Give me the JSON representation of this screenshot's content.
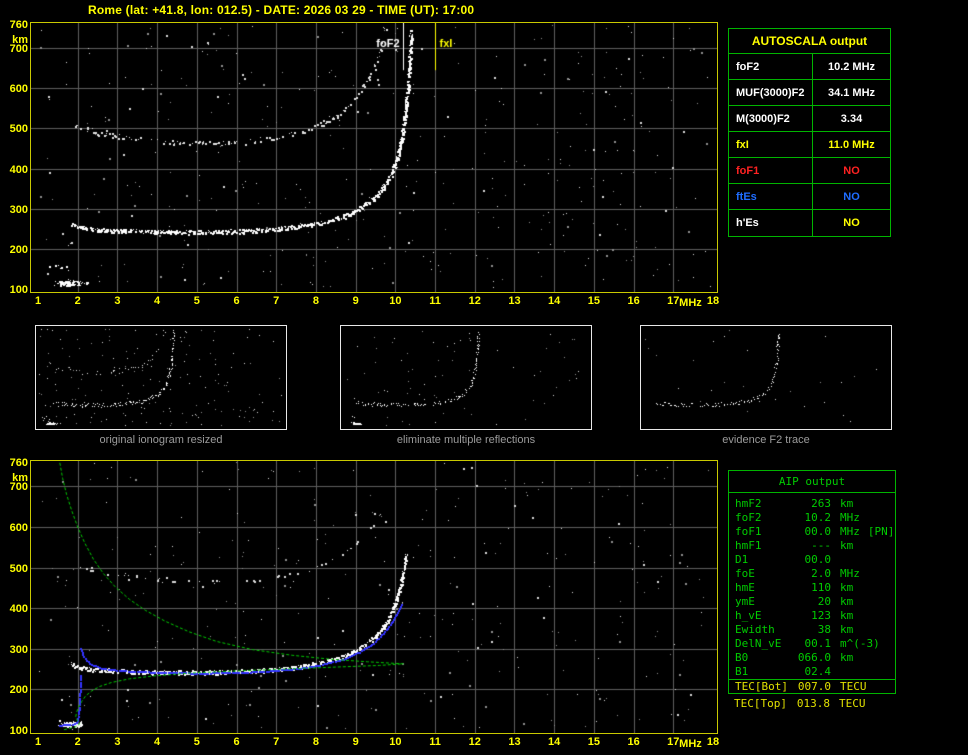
{
  "title": "Rome (lat: +41.8, lon: 012.5) - DATE: 2026 03 29 - TIME (UT): 17:00",
  "autoscala_table": {
    "header": "AUTOSCALA output",
    "rows": [
      {
        "label": "foF2",
        "value": "10.2 MHz",
        "color": "#ffffff"
      },
      {
        "label": "MUF(3000)F2",
        "value": "34.1 MHz",
        "color": "#ffffff"
      },
      {
        "label": "M(3000)F2",
        "value": "3.34",
        "color": "#ffffff"
      },
      {
        "label": "fxI",
        "value": "11.0 MHz",
        "color": "#ffff00"
      },
      {
        "label": "foF1",
        "value": "NO",
        "color": "#ff2222"
      },
      {
        "label": "ftEs",
        "value": "NO",
        "color": "#1f6dff"
      },
      {
        "label": "h'Es",
        "value": "NO",
        "color": "#ffffff",
        "value_color": "#ffff00"
      }
    ]
  },
  "aip_table": {
    "header": "AIP output",
    "rows": [
      {
        "label": "hmF2",
        "value": "263",
        "unit": "km",
        "extra": ""
      },
      {
        "label": "foF2",
        "value": "10.2",
        "unit": "MHz",
        "extra": ""
      },
      {
        "label": "foF1",
        "value": "00.0",
        "unit": "MHz",
        "extra": "[PN]"
      },
      {
        "label": "hmF1",
        "value": "---",
        "unit": "km",
        "extra": ""
      },
      {
        "label": "D1",
        "value": "00.0",
        "unit": "",
        "extra": ""
      },
      {
        "label": "foE",
        "value": "2.0",
        "unit": "MHz",
        "extra": ""
      },
      {
        "label": "hmE",
        "value": "110",
        "unit": "km",
        "extra": ""
      },
      {
        "label": "ymE",
        "value": "20",
        "unit": "km",
        "extra": ""
      },
      {
        "label": "h_vE",
        "value": "123",
        "unit": "km",
        "extra": ""
      },
      {
        "label": "Ewidth",
        "value": "38",
        "unit": "km",
        "extra": ""
      },
      {
        "label": "DelN_vE",
        "value": "00.1",
        "unit": "m^(-3)",
        "extra": ""
      },
      {
        "label": "B0",
        "value": "066.0",
        "unit": "km",
        "extra": ""
      },
      {
        "label": "B1",
        "value": "02.4",
        "unit": "",
        "extra": ""
      }
    ],
    "tec_bot": {
      "label": "TEC[Bot]",
      "value": "007.0",
      "unit": "TECU"
    },
    "tec_top": {
      "label": "TEC[Top]",
      "value": "013.8",
      "unit": "TECU"
    }
  },
  "thumbnails": [
    {
      "caption": "original ionogram resized",
      "trace_refs": [
        {
          "id": "f2",
          "d": 0.55
        },
        {
          "id": "upper",
          "d": 0.55
        },
        {
          "id": "es",
          "d": 0.6
        },
        {
          "id": "es-arc",
          "d": 0.6
        },
        {
          "id": "noise",
          "d": 0.45
        }
      ]
    },
    {
      "caption": "eliminate multiple reflections",
      "trace_refs": [
        {
          "id": "f2",
          "d": 0.55
        },
        {
          "id": "es",
          "d": 0.5
        },
        {
          "id": "es-arc",
          "d": 0.5
        },
        {
          "id": "noise",
          "d": 0.18
        }
      ]
    },
    {
      "caption": "evidence F2 trace",
      "trace_refs": [
        {
          "id": "f2",
          "d": 0.4
        },
        {
          "id": "noise",
          "d": 0.07
        }
      ]
    }
  ],
  "chart_data": [
    {
      "id": "ionogram_measured",
      "type": "scatter",
      "xlabel": "MHz",
      "ylabel": "km",
      "xlim": [
        1,
        18
      ],
      "ylim": [
        100,
        760
      ],
      "x_ticks": [
        1,
        2,
        3,
        4,
        5,
        6,
        7,
        8,
        9,
        10,
        11,
        12,
        13,
        14,
        15,
        16,
        17,
        18
      ],
      "y_ticks": [
        760,
        700,
        600,
        500,
        400,
        300,
        200,
        100
      ],
      "markers": [
        {
          "label": "foF2",
          "mhz": 10.2,
          "color": "#ffffff",
          "label_side": "left",
          "line_to_km": 645
        },
        {
          "label": "fxI",
          "mhz": 11.0,
          "color": "#ffff00",
          "label_side": "right",
          "line_to_km": 645
        }
      ],
      "traces": [
        {
          "id": "f2",
          "kind": "scatter-path",
          "color": "#ffffff",
          "density": 2.0,
          "jitter": 2.6,
          "gap": 0.3,
          "anchors": [
            [
              1.85,
              262
            ],
            [
              2.1,
              252
            ],
            [
              2.5,
              247
            ],
            [
              3.2,
              244
            ],
            [
              4.0,
              242
            ],
            [
              5.0,
              241
            ],
            [
              6.0,
              243
            ],
            [
              6.8,
              247
            ],
            [
              7.5,
              254
            ],
            [
              8.1,
              264
            ],
            [
              8.7,
              280
            ],
            [
              9.1,
              300
            ],
            [
              9.45,
              324
            ],
            [
              9.7,
              352
            ],
            [
              9.9,
              386
            ],
            [
              10.05,
              425
            ],
            [
              10.15,
              465
            ],
            [
              10.22,
              510
            ],
            [
              10.28,
              560
            ],
            [
              10.33,
              615
            ],
            [
              10.37,
              680
            ],
            [
              10.4,
              745
            ]
          ]
        },
        {
          "id": "upper",
          "kind": "scatter-path",
          "color": "#e0e0e0",
          "density": 0.9,
          "jitter": 3.2,
          "gap": 0.55,
          "anchors": [
            [
              1.9,
              510
            ],
            [
              2.4,
              492
            ],
            [
              3.0,
              478
            ],
            [
              4.0,
              468
            ],
            [
              5.0,
              462
            ],
            [
              6.0,
              464
            ],
            [
              6.8,
              472
            ],
            [
              7.5,
              486
            ],
            [
              8.1,
              508
            ],
            [
              8.6,
              536
            ],
            [
              9.0,
              572
            ],
            [
              9.3,
              615
            ],
            [
              9.55,
              668
            ],
            [
              9.7,
              725
            ],
            [
              9.76,
              755
            ]
          ]
        },
        {
          "id": "es",
          "kind": "blob",
          "color": "#ffffff",
          "n": 80,
          "center": [
            1.85,
            115
          ],
          "spread": [
            0.5,
            11
          ]
        },
        {
          "id": "es-arc",
          "kind": "scatter-path",
          "color": "#ffffff",
          "density": 0.6,
          "jitter": 2.5,
          "gap": 0.45,
          "anchors": [
            [
              1.3,
              160
            ],
            [
              1.6,
              153
            ],
            [
              1.95,
              149
            ]
          ]
        },
        {
          "id": "noise",
          "kind": "noise",
          "n": 380
        }
      ]
    },
    {
      "id": "ionogram_restored_with_profile",
      "type": "scatter",
      "xlabel": "MHz",
      "ylabel": "km",
      "xlim": [
        1,
        18
      ],
      "ylim": [
        100,
        760
      ],
      "x_ticks": [
        1,
        2,
        3,
        4,
        5,
        6,
        7,
        8,
        9,
        10,
        11,
        12,
        13,
        14,
        15,
        16,
        17,
        18
      ],
      "y_ticks": [
        760,
        700,
        600,
        500,
        400,
        300,
        200,
        100
      ],
      "markers": [],
      "traces": [
        {
          "id": "f2",
          "kind": "scatter-path",
          "color": "#ffffff",
          "density": 2.0,
          "jitter": 2.6,
          "gap": 0.3,
          "anchors": [
            [
              1.85,
              262
            ],
            [
              2.1,
              252
            ],
            [
              2.5,
              247
            ],
            [
              3.2,
              244
            ],
            [
              4.0,
              242
            ],
            [
              5.0,
              241
            ],
            [
              6.0,
              243
            ],
            [
              6.8,
              247
            ],
            [
              7.5,
              254
            ],
            [
              8.1,
              264
            ],
            [
              8.7,
              280
            ],
            [
              9.1,
              300
            ],
            [
              9.45,
              324
            ],
            [
              9.7,
              352
            ],
            [
              9.9,
              386
            ],
            [
              10.05,
              425
            ],
            [
              10.15,
              462
            ],
            [
              10.22,
              500
            ],
            [
              10.28,
              535
            ]
          ]
        },
        {
          "id": "upper",
          "kind": "scatter-path",
          "color": "#d8d8d8",
          "density": 0.5,
          "jitter": 3.2,
          "gap": 0.72,
          "anchors": [
            [
              2.0,
              505
            ],
            [
              2.6,
              490
            ],
            [
              3.4,
              475
            ],
            [
              4.4,
              468
            ],
            [
              5.5,
              465
            ],
            [
              6.6,
              470
            ],
            [
              7.5,
              485
            ],
            [
              8.2,
              508
            ],
            [
              8.8,
              540
            ],
            [
              9.2,
              575
            ],
            [
              9.5,
              620
            ]
          ]
        },
        {
          "id": "es",
          "kind": "blob",
          "color": "#ffffff",
          "n": 70,
          "center": [
            1.85,
            114
          ],
          "spread": [
            0.5,
            10
          ]
        },
        {
          "id": "noise",
          "kind": "noise",
          "n": 330
        },
        {
          "id": "restored-e",
          "kind": "dotline",
          "color": "#3333ff",
          "anchors": [
            [
              1.55,
              112
            ],
            [
              1.8,
              113
            ],
            [
              1.98,
              118
            ],
            [
              2.03,
              145
            ],
            [
              2.06,
              195
            ],
            [
              2.08,
              235
            ]
          ]
        },
        {
          "id": "restored-f2",
          "kind": "dotline",
          "color": "#3333ff",
          "anchors": [
            [
              2.08,
              300
            ],
            [
              2.15,
              280
            ],
            [
              2.3,
              264
            ],
            [
              2.6,
              252
            ],
            [
              3.1,
              246
            ],
            [
              4.0,
              242
            ],
            [
              5.0,
              240
            ],
            [
              6.0,
              241
            ],
            [
              6.8,
              245
            ],
            [
              7.5,
              251
            ],
            [
              8.1,
              260
            ],
            [
              8.7,
              274
            ],
            [
              9.1,
              292
            ],
            [
              9.45,
              314
            ],
            [
              9.7,
              338
            ],
            [
              9.9,
              364
            ],
            [
              10.05,
              390
            ],
            [
              10.15,
              408
            ]
          ]
        },
        {
          "id": "profile",
          "kind": "polyline",
          "color": "#00cc00",
          "width": 1,
          "dash": [
            3,
            2
          ],
          "anchors": [
            [
              1.55,
              758
            ],
            [
              1.62,
              720
            ],
            [
              1.72,
              680
            ],
            [
              1.85,
              640
            ],
            [
              2.0,
              600
            ],
            [
              2.18,
              560
            ],
            [
              2.4,
              520
            ],
            [
              2.65,
              485
            ],
            [
              2.95,
              452
            ],
            [
              3.3,
              422
            ],
            [
              3.7,
              395
            ],
            [
              4.2,
              368
            ],
            [
              4.8,
              342
            ],
            [
              5.5,
              318
            ],
            [
              6.4,
              298
            ],
            [
              7.4,
              284
            ],
            [
              8.4,
              274
            ],
            [
              9.3,
              268
            ],
            [
              10.0,
              264
            ],
            [
              10.2,
              263
            ],
            [
              9.6,
              259
            ],
            [
              8.5,
              255
            ],
            [
              7.2,
              250
            ],
            [
              5.9,
              245
            ],
            [
              4.8,
              240
            ],
            [
              3.9,
              233
            ],
            [
              3.3,
              226
            ],
            [
              2.85,
              217
            ],
            [
              2.55,
              207
            ],
            [
              2.35,
              196
            ],
            [
              2.2,
              184
            ],
            [
              2.1,
              170
            ],
            [
              2.02,
              156
            ],
            [
              1.97,
              143
            ],
            [
              1.95,
              132
            ],
            [
              2.0,
              122
            ],
            [
              2.05,
              115
            ],
            [
              1.95,
              108
            ],
            [
              1.75,
              103
            ],
            [
              1.62,
              100
            ]
          ]
        }
      ]
    }
  ]
}
